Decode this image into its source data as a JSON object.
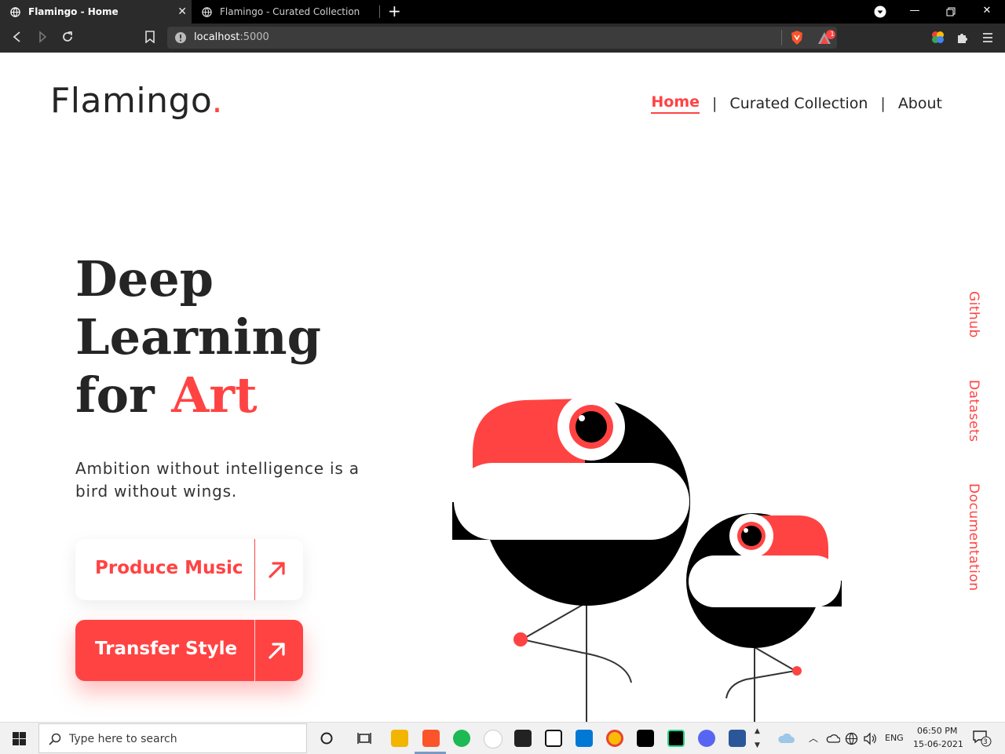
{
  "browser": {
    "tabs": [
      {
        "title": "Flamingo - Home",
        "active": true
      },
      {
        "title": "Flamingo - Curated Collection",
        "active": false
      }
    ],
    "url": {
      "host": "localhost",
      "port": ":5000"
    },
    "badge_count": "1"
  },
  "site": {
    "logo": {
      "text": "Flamingo",
      "dot": "."
    },
    "nav": {
      "home": "Home",
      "sep1": "|",
      "collection": "Curated Collection",
      "sep2": "|",
      "about": "About"
    },
    "hero": {
      "title_line1": "Deep",
      "title_line2": "Learning",
      "title_line3_prefix": "for ",
      "title_line3_accent": "Art",
      "tagline": "Ambition without intelligence is a bird without wings."
    },
    "buttons": {
      "music": "Produce Music",
      "style": "Transfer Style"
    },
    "side_links": {
      "github": "Github",
      "datasets": "Datasets",
      "documentation": "Documentation"
    },
    "colors": {
      "accent": "#ff4343",
      "text": "#252525"
    }
  },
  "taskbar": {
    "search_placeholder": "Type here to search",
    "language": "ENG",
    "time": "06:50 PM",
    "date": "15-06-2021",
    "notification_count": "3"
  }
}
